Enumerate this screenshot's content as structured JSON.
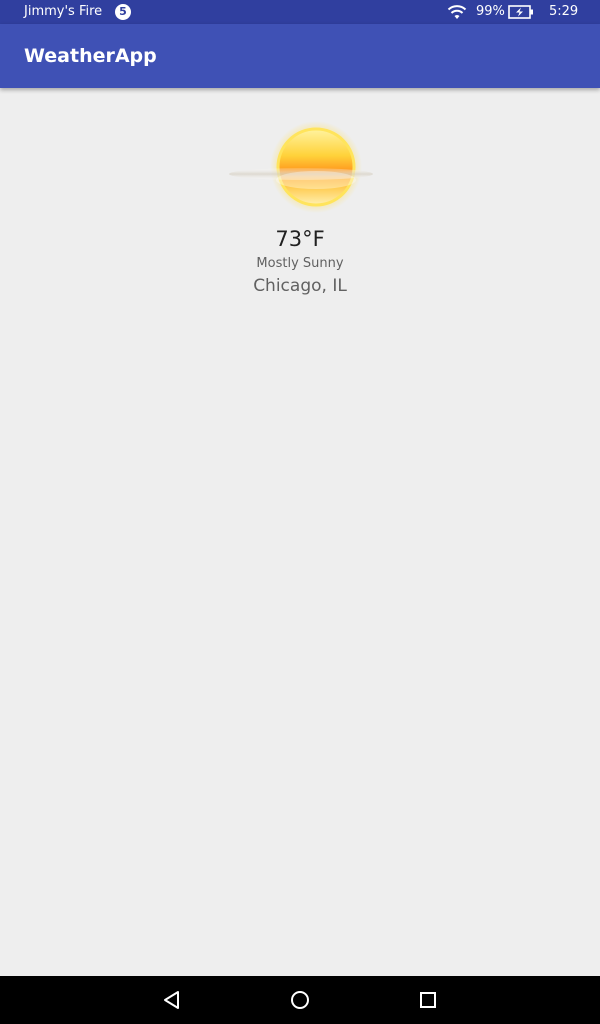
{
  "status_bar": {
    "device_name": "Jimmy's Fire",
    "notification_count": "5",
    "battery_percent": "99%",
    "time": "5:29"
  },
  "app_bar": {
    "title": "WeatherApp"
  },
  "weather": {
    "icon": "sun-behind-cloud-icon",
    "temperature": "73°F",
    "condition": "Mostly Sunny",
    "location": "Chicago, IL"
  },
  "nav_bar": {
    "buttons": [
      "back-icon",
      "home-icon",
      "recents-icon"
    ]
  },
  "colors": {
    "status_bar": "#303f9f",
    "app_bar": "#3f51b5",
    "background": "#eeeeee"
  }
}
